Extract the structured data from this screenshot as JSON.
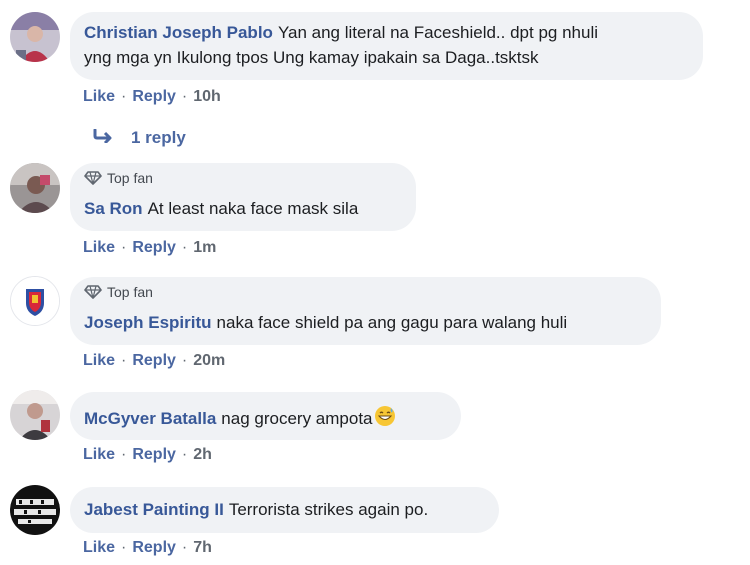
{
  "comments": [
    {
      "author": "Christian Joseph Pablo",
      "text_line1": "Yan ang literal na Faceshield.. dpt pg nhuli",
      "text_line2": "yng mga yn Ikulong tpos Ung kamay ipakain sa Daga..tsktsk",
      "like": "Like",
      "reply": "Reply",
      "time": "10h",
      "replies_label": "1 reply"
    },
    {
      "badge": "Top fan",
      "author": "Sa Ron",
      "text": "At least naka face mask sila",
      "like": "Like",
      "reply": "Reply",
      "time": "1m"
    },
    {
      "badge": "Top fan",
      "author": "Joseph Espiritu",
      "text": "naka face shield pa ang gagu para walang huli",
      "like": "Like",
      "reply": "Reply",
      "time": "20m"
    },
    {
      "author": "McGyver Batalla",
      "text": "nag grocery ampota",
      "emoji": "grinning-sweat-emoji",
      "like": "Like",
      "reply": "Reply",
      "time": "2h"
    },
    {
      "author": "Jabest Painting II",
      "text": "Terrorista strikes again po.",
      "like": "Like",
      "reply": "Reply",
      "time": "7h"
    }
  ],
  "icons": {
    "badge_icon": "diamond-icon",
    "reply_icon": "reply-arrow-icon"
  },
  "colors": {
    "author": "#385898",
    "bubble": "#f0f2f5",
    "action_link": "#4b67a1",
    "meta": "#606770"
  }
}
